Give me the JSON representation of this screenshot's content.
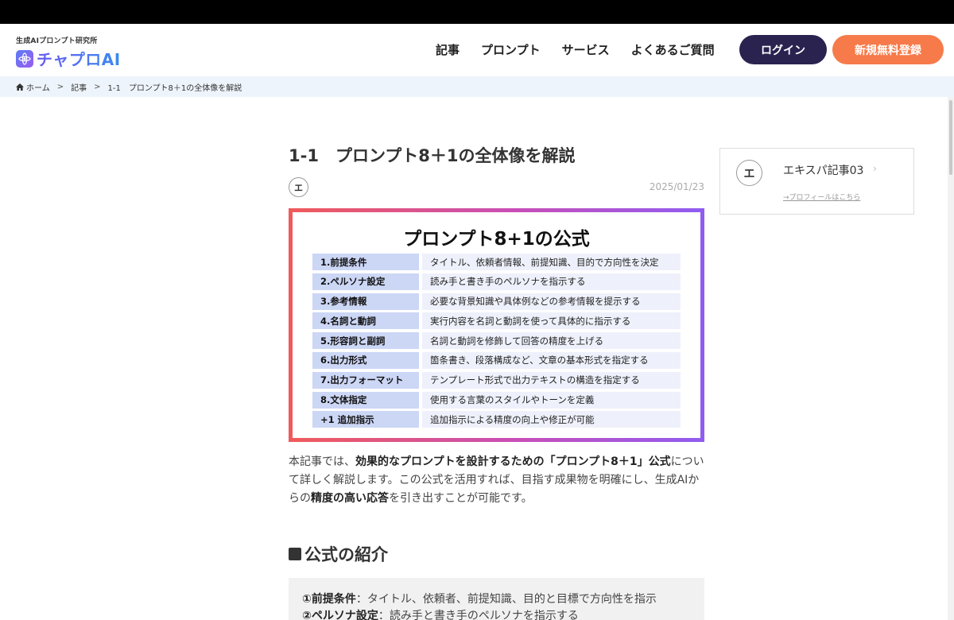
{
  "header": {
    "logo_tagline": "生成AIプロンプト研究所",
    "logo_text": "チャプロAI",
    "nav": [
      {
        "label": "記事"
      },
      {
        "label": "プロンプト"
      },
      {
        "label": "サービス"
      },
      {
        "label": "よくあるご質問"
      }
    ],
    "login_label": "ログイン",
    "register_label": "新規無料登録"
  },
  "breadcrumb": {
    "home": "ホーム",
    "category": "記事",
    "current": "1-1　プロンプト8＋1の全体像を解説",
    "separator": ">"
  },
  "article": {
    "title": "1-1　プロンプト8＋1の全体像を解説",
    "author_initial": "エ",
    "date": "2025/01/23",
    "hero": {
      "title": "プロンプト8+1の公式",
      "rows": [
        {
          "k": "1.前提条件",
          "v": "タイトル、依頼者情報、前提知識、目的で方向性を決定"
        },
        {
          "k": "2.ペルソナ設定",
          "v": "読み手と書き手のペルソナを指示する"
        },
        {
          "k": "3.参考情報",
          "v": "必要な背景知識や具体例などの参考情報を提示する"
        },
        {
          "k": "4.名詞と動詞",
          "v": "実行内容を名詞と動詞を使って具体的に指示する"
        },
        {
          "k": "5.形容詞と副詞",
          "v": "名詞と動詞を修飾して回答の精度を上げる"
        },
        {
          "k": "6.出力形式",
          "v": "箇条書き、段落構成など、文章の基本形式を指定する"
        },
        {
          "k": "7.出力フォーマット",
          "v": "テンプレート形式で出力テキストの構造を指定する"
        },
        {
          "k": "8.文体指定",
          "v": "使用する言葉のスタイルやトーンを定義"
        },
        {
          "k": "+1 追加指示",
          "v": "追加指示による精度の向上や修正が可能"
        }
      ]
    },
    "intro": {
      "p1": "本記事では、",
      "b1": "効果的なプロンプトを設計するための「プロンプト8＋1」公式",
      "p2": "について詳しく解説します。この公式を活用すれば、目指す成果物を明確にし、生成AIからの",
      "b2": "精度の高い応答",
      "p3": "を引き出すことが可能です。"
    },
    "section_heading": "公式の紹介",
    "formula": [
      {
        "label": "①前提条件",
        "text": "：タイトル、依頼者、前提知識、目的と目標で方向性を指示"
      },
      {
        "label": "②ペルソナ設定",
        "text": "：読み手と書き手のペルソナを指示する"
      }
    ]
  },
  "sidebar": {
    "author_name": "エキスパ記事03",
    "author_initial": "エ",
    "profile_link": "→プロフィールはこちら"
  }
}
